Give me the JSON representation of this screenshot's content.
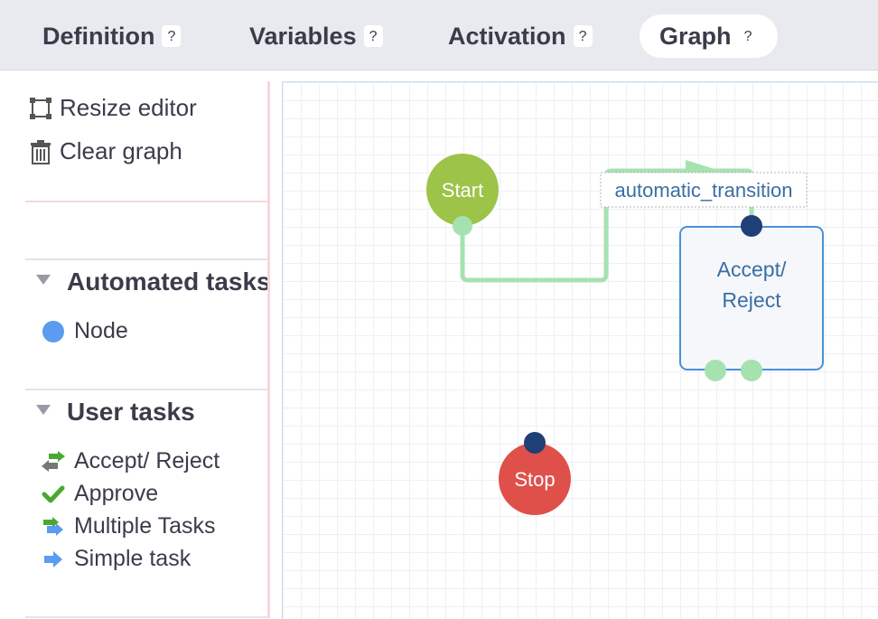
{
  "tabs": [
    {
      "label": "Definition",
      "help": "?"
    },
    {
      "label": "Variables",
      "help": "?"
    },
    {
      "label": "Activation",
      "help": "?"
    },
    {
      "label": "Graph",
      "help": "?"
    }
  ],
  "tools": {
    "resize_label": "Resize editor",
    "clear_label": "Clear graph"
  },
  "sections": {
    "automated": {
      "title": "Automated tasks",
      "items": [
        {
          "label": "Node",
          "icon": "blue-circle-icon"
        }
      ]
    },
    "user": {
      "title": "User tasks",
      "items": [
        {
          "label": "Accept/ Reject",
          "icon": "accept-reject-arrows-icon"
        },
        {
          "label": "Approve",
          "icon": "checkmark-icon"
        },
        {
          "label": "Multiple Tasks",
          "icon": "multiple-tasks-arrows-icon"
        },
        {
          "label": "Simple task",
          "icon": "right-arrow-icon"
        }
      ]
    }
  },
  "graph": {
    "start_label": "Start",
    "stop_label": "Stop",
    "task_label_line1": "Accept/",
    "task_label_line2": "Reject",
    "transition_label": "automatic_transition"
  },
  "colors": {
    "start": "#9dc348",
    "stop": "#e0504a",
    "edge": "#a6e2b0",
    "port_in": "#1f3f77",
    "task_border": "#4a90d9",
    "task_text": "#3a6ea5"
  }
}
